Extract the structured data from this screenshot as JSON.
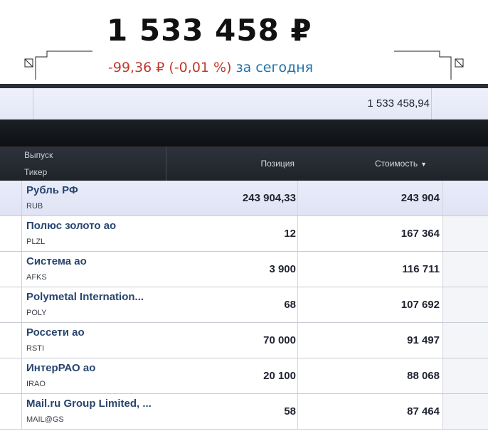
{
  "summary": {
    "total": "1 533 458 ₽",
    "change": "-99,36 ₽ (-0,01 %)",
    "change_period": "за сегодня"
  },
  "totals_row": {
    "value": "1 533 458,94"
  },
  "table": {
    "header": {
      "issue": "Выпуск",
      "ticker": "Тикер",
      "position": "Позиция",
      "value": "Стоимость",
      "sort_icon": "triangle-down-icon"
    },
    "rows": [
      {
        "name": "Рубль РФ",
        "ticker": "RUB",
        "position": "243 904,33",
        "value": "243 904"
      },
      {
        "name": "Полюс золото ао",
        "ticker": "PLZL",
        "position": "12",
        "value": "167 364"
      },
      {
        "name": "Система ао",
        "ticker": "AFKS",
        "position": "3 900",
        "value": "116 711"
      },
      {
        "name": "Polymetal Internation...",
        "ticker": "POLY",
        "position": "68",
        "value": "107 692"
      },
      {
        "name": "Россети ао",
        "ticker": "RSTI",
        "position": "70 000",
        "value": "91 497"
      },
      {
        "name": "ИнтерРАО ао",
        "ticker": "IRAO",
        "position": "20 100",
        "value": "88 068"
      },
      {
        "name": "Mail.ru Group Limited, ...",
        "ticker": "MAIL@GS",
        "position": "58",
        "value": "87 464"
      }
    ]
  },
  "colors": {
    "negative": "#c0392b",
    "period": "#1e73a8",
    "name": "#28456f"
  }
}
